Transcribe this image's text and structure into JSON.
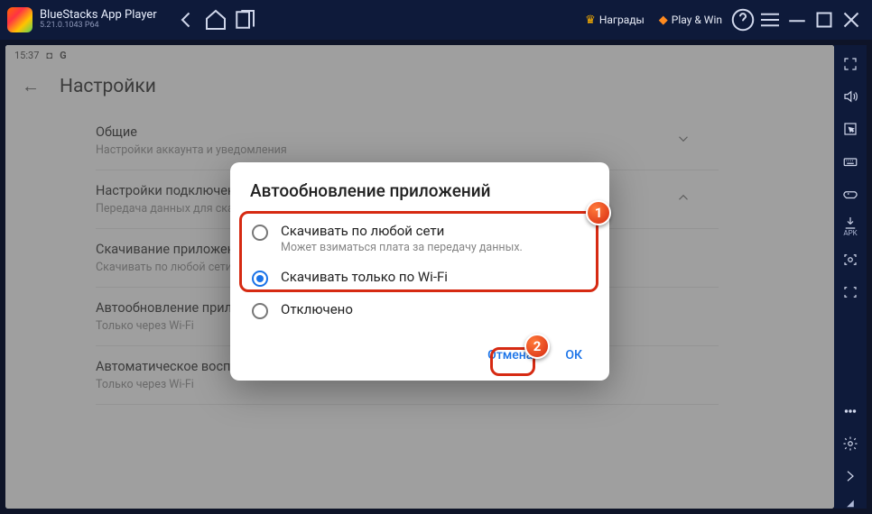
{
  "titlebar": {
    "app_title": "BlueStacks App Player",
    "app_sub": "5.21.0.1043  P64",
    "rewards": "Награды",
    "playwin": "Play & Win"
  },
  "status": {
    "time": "15:37"
  },
  "page": {
    "title": "Настройки"
  },
  "sections": [
    {
      "title": "Общие",
      "sub": "Настройки аккаунта и уведомления",
      "expanded": false
    },
    {
      "title": "Настройки подключения",
      "sub": "Передача данных для скачивания",
      "expanded": true
    },
    {
      "title": "Скачивание приложений",
      "sub": "Скачивать по любой сети",
      "expanded": false
    },
    {
      "title": "Автообновление приложений",
      "sub": "Только через Wi-Fi",
      "expanded": false
    },
    {
      "title": "Автоматическое воспроизведение видео",
      "sub": "Только через Wi-Fi",
      "expanded": false
    }
  ],
  "dialog": {
    "title": "Автообновление приложений",
    "options": [
      {
        "label": "Скачивать по любой сети",
        "sub": "Может взиматься плата за передачу данных.",
        "selected": false
      },
      {
        "label": "Скачивать только по Wi-Fi",
        "sub": "",
        "selected": true
      },
      {
        "label": "Отключено",
        "sub": "",
        "selected": false
      }
    ],
    "cancel": "Отмена",
    "ok": "ОК"
  },
  "callouts": {
    "one": "1",
    "two": "2"
  },
  "sidebar": {
    "apk_label": "APK"
  }
}
